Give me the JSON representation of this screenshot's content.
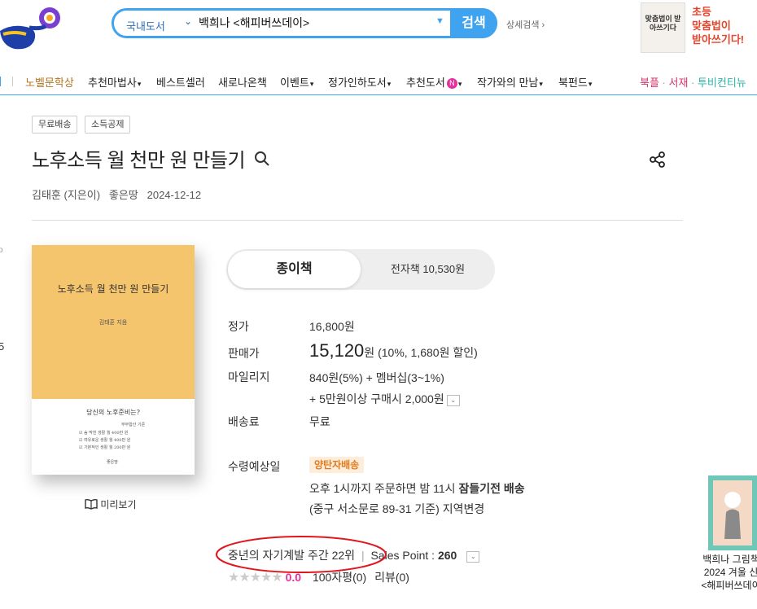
{
  "header": {
    "search": {
      "category": "국내도서",
      "query": "백희나 <해피버쓰데이>",
      "button_label": "검색",
      "advanced_label": "상세검색 ›"
    },
    "ad": {
      "book_text": "맞춤법이 받아쓰기다",
      "lines": [
        "초등",
        "맞춤법이",
        "받아쓰기다!"
      ]
    }
  },
  "nav": {
    "items": [
      {
        "label": "노벨문학상",
        "highlight": true
      },
      {
        "label": "추천마법사",
        "caret": true
      },
      {
        "label": "베스트셀러"
      },
      {
        "label": "새로나온책"
      },
      {
        "label": "이벤트",
        "caret": true
      },
      {
        "label": "정가인하도서",
        "caret": true
      },
      {
        "label": "추천도서",
        "badge": "N",
        "caret": true
      },
      {
        "label": "작가와의 만남",
        "caret": true
      },
      {
        "label": "북펀드",
        "caret": true
      }
    ],
    "right": [
      {
        "label": "북플",
        "color": "#d6336c"
      },
      {
        "label": "서재",
        "color": "#d6336c"
      },
      {
        "label": "투비컨티뉴",
        "color": "#2bb3a7"
      }
    ]
  },
  "product": {
    "tags": [
      "무료배송",
      "소득공제"
    ],
    "title": "노후소득 월 천만 원 만들기",
    "author": "김태훈 (지은이)",
    "publisher": "좋은땅",
    "date": "2024-12-12",
    "cover": {
      "title": "노후소득 월 천만 원 만들기",
      "author": "김태훈 지음",
      "question": "당신의 노후준비는?",
      "sub": "부부합산 기준",
      "lines": [
        "☑ 숨 막힌 생활  월 400만 원",
        "☑ 여유로운 생활  월 400만 원",
        "☑ 기본적인 생활  월 200만 원"
      ],
      "publisher": "좋은땅"
    },
    "preview_label": "미리보기"
  },
  "formats": {
    "paper": "종이책",
    "ebook": "전자책 10,530원"
  },
  "pricing": {
    "list_label": "정가",
    "list_price": "16,800원",
    "sale_label": "판매가",
    "sale_price": "15,120",
    "sale_unit": "원",
    "sale_detail": "(10%, 1,680원 할인)",
    "mileage_label": "마일리지",
    "mileage_line1": "840원(5%) + 멤버십(3~1%)",
    "mileage_line2": "+ 5만원이상 구매시 2,000원",
    "shipping_label": "배송료",
    "shipping_value": "무료",
    "delivery_label": "수령예상일",
    "delivery_badge": "양탄자배송",
    "delivery_line1_a": "오후 1시까지 주문하면 밤 11시 ",
    "delivery_line1_b": "잠들기전 배송",
    "delivery_line2": "(중구 서소문로 89-31 기준) 지역변경"
  },
  "sales": {
    "rank": "중년의 자기계발 주간 22위",
    "separator": "|",
    "sales_point_label": "Sales Point : ",
    "sales_point_value": "260",
    "rating_value": "0.0",
    "rating_stars": 0,
    "review_100": "100자평(0)",
    "reviews": "리뷰(0)"
  },
  "side_promo": {
    "line1": "백희나 그림책",
    "line2": "2024 겨울 신",
    "line3": "<해피버쓰데이"
  },
  "edge": {
    "frag1": "o",
    "frag2": "5"
  }
}
